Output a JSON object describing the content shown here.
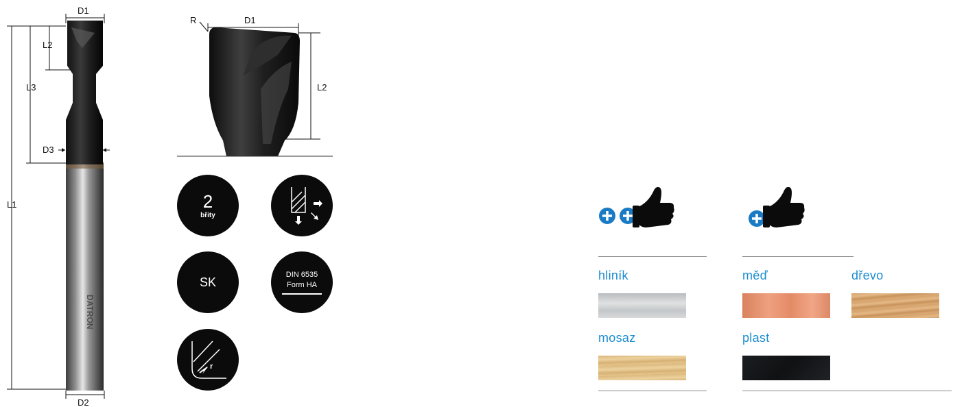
{
  "tool_drawing": {
    "labels": {
      "d1_left": "D1",
      "d2": "D2",
      "d3": "D3",
      "l1": "L1",
      "l2_left": "L2",
      "l3": "L3",
      "r": "R",
      "d1_right": "D1",
      "l2_right": "L2",
      "brand": "DATRON"
    }
  },
  "badges": {
    "flutes_number": "2",
    "flutes_label": "břity",
    "material": "SK",
    "norm_line1": "DIN 6535",
    "norm_line2": "Form HA",
    "radius_label": "r"
  },
  "suitability": {
    "very_good_icon": "plus-plus-thumbs-up-icon",
    "good_icon": "plus-thumbs-up-icon",
    "materials": [
      {
        "label": "hliník",
        "color": "#c9ccce"
      },
      {
        "label": "měď",
        "color": "#e49470"
      },
      {
        "label": "dřevo",
        "color": "#d8a772"
      },
      {
        "label": "mosaz",
        "color": "#e2c48c"
      },
      {
        "label": "plast",
        "color": "#141618"
      }
    ]
  },
  "colors": {
    "accent": "#1a8ccf",
    "badge": "#0b0b0b",
    "plus_icon": "#1a7bc4"
  }
}
